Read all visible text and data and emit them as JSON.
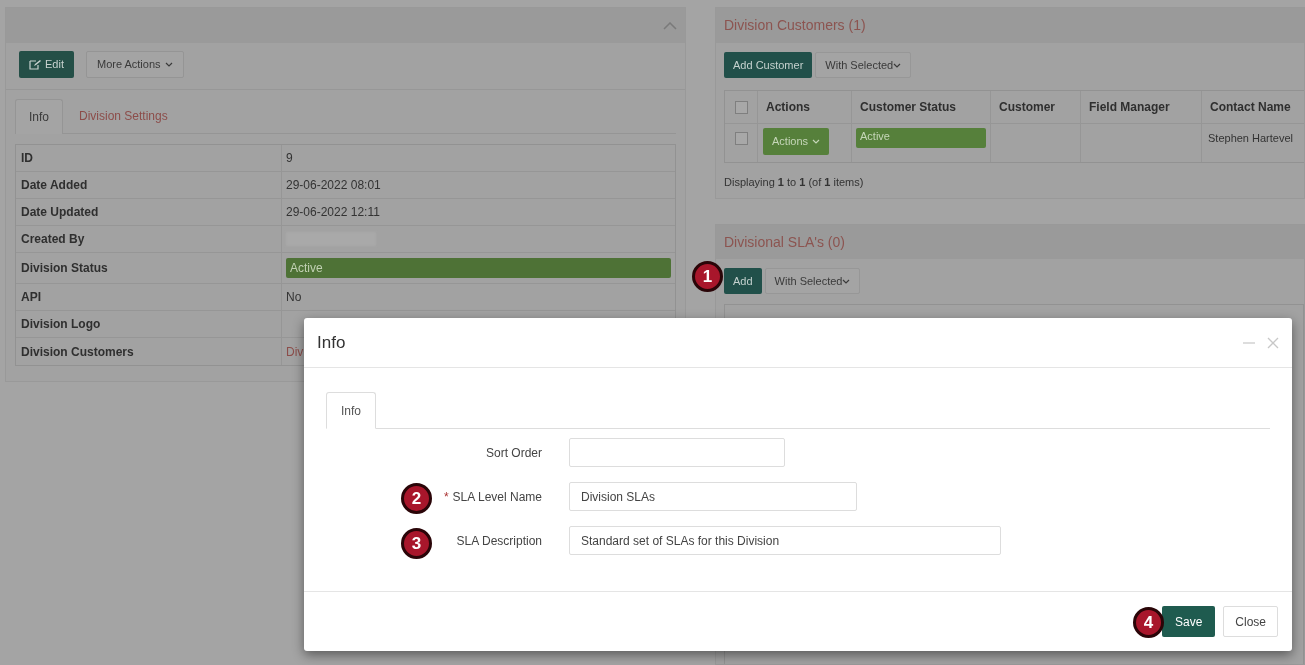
{
  "division_panel": {
    "edit_button": "Edit",
    "more_actions": "More Actions",
    "tabs": [
      {
        "label": "Info",
        "selected": true
      },
      {
        "label": "Division Settings",
        "selected": false
      }
    ],
    "rows": [
      {
        "label": "ID",
        "value": "9",
        "kind": "text"
      },
      {
        "label": "Date Added",
        "value": "29-06-2022 08:01",
        "kind": "text"
      },
      {
        "label": "Date Updated",
        "value": "29-06-2022 12:11",
        "kind": "text"
      },
      {
        "label": "Created By",
        "kind": "blurred"
      },
      {
        "label": "Division Status",
        "value": "Active",
        "kind": "status"
      },
      {
        "label": "API",
        "value": "No",
        "kind": "text"
      },
      {
        "label": "Division Logo",
        "kind": "empty"
      },
      {
        "label": "Division Customers",
        "value": "Div",
        "kind": "link"
      }
    ]
  },
  "customers_panel": {
    "title": "Division Customers (1)",
    "add_button": "Add Customer",
    "with_selected": "With Selected",
    "select_all_checked": false,
    "columns": [
      "Actions",
      "Customer Status",
      "Customer",
      "Field Manager",
      "Contact Name"
    ],
    "rows": [
      {
        "checked": false,
        "actions": "Actions",
        "status": "Active",
        "contact": "Stephen Hartevel"
      }
    ],
    "footer": "Displaying **1** to **1** (of **1** items)"
  },
  "sla_panel": {
    "title": "Divisional SLA's (0)",
    "add_button": "Add",
    "with_selected": "With Selected"
  },
  "modal": {
    "title": "Info",
    "tabs": [
      {
        "label": "Info",
        "selected": true
      }
    ],
    "fields": [
      {
        "label": "Sort Order",
        "required": false
      },
      {
        "label": "SLA Level Name",
        "required": true,
        "value": "Division SLAs"
      },
      {
        "label": "SLA Description",
        "required": false,
        "value": "Standard set of SLAs for this Division"
      }
    ],
    "required_mark": "*",
    "save": "Save",
    "close": "Close"
  },
  "callouts": [
    "1",
    "2",
    "3",
    "4"
  ]
}
